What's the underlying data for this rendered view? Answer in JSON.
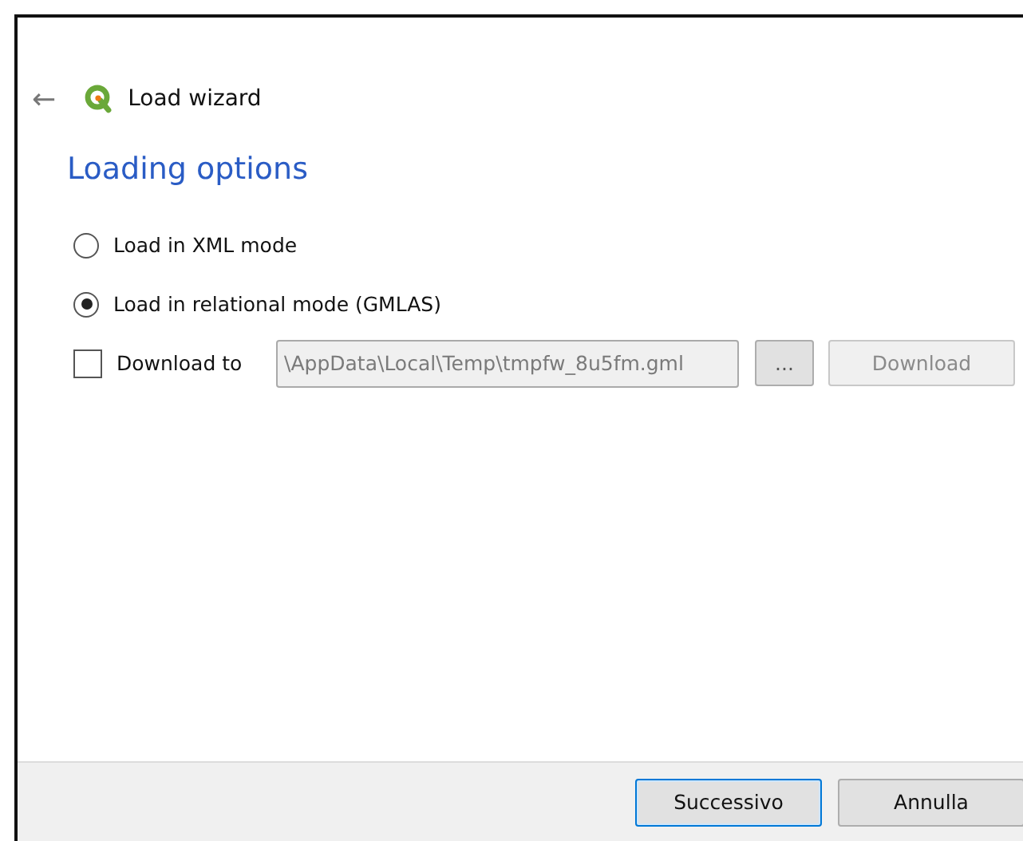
{
  "header": {
    "back_icon": "←",
    "title": "Load wizard"
  },
  "page_title": "Loading options",
  "options": [
    {
      "label": "Load in XML mode",
      "selected": false
    },
    {
      "label": "Load in relational mode (GMLAS)",
      "selected": true
    }
  ],
  "download": {
    "label": "Download to",
    "checked": false,
    "path": "\\AppData\\Local\\Temp\\tmpfw_8u5fm.gml",
    "path_disabled": true,
    "browse": "...",
    "browse_disabled": false,
    "button": "Download",
    "button_disabled": true
  },
  "buttons": [
    {
      "label": "Successivo",
      "default": true
    },
    {
      "label": "Annulla",
      "default": false
    }
  ]
}
